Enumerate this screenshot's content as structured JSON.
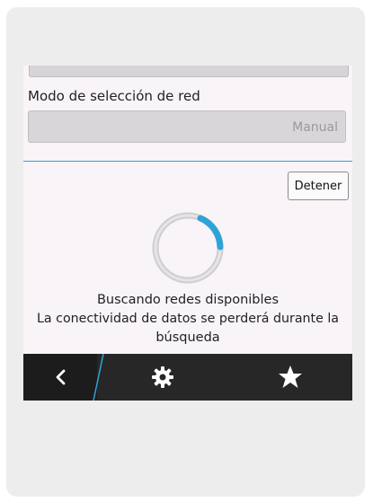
{
  "network": {
    "mode_label": "Modo de selección de red",
    "mode_value": "Manual",
    "stop_button_label": "Detener",
    "status_line1": "Buscando redes disponibles",
    "status_line2": "La conectividad de datos se perderá durante la",
    "status_line3": "búsqueda"
  },
  "action_bar": {
    "items": [
      "back-icon",
      "settings-gear-icon",
      "favorites-star-icon"
    ]
  },
  "colors": {
    "accent": "#2ea3d6",
    "background": "#f8f4f8",
    "action_bar": "#272727"
  }
}
